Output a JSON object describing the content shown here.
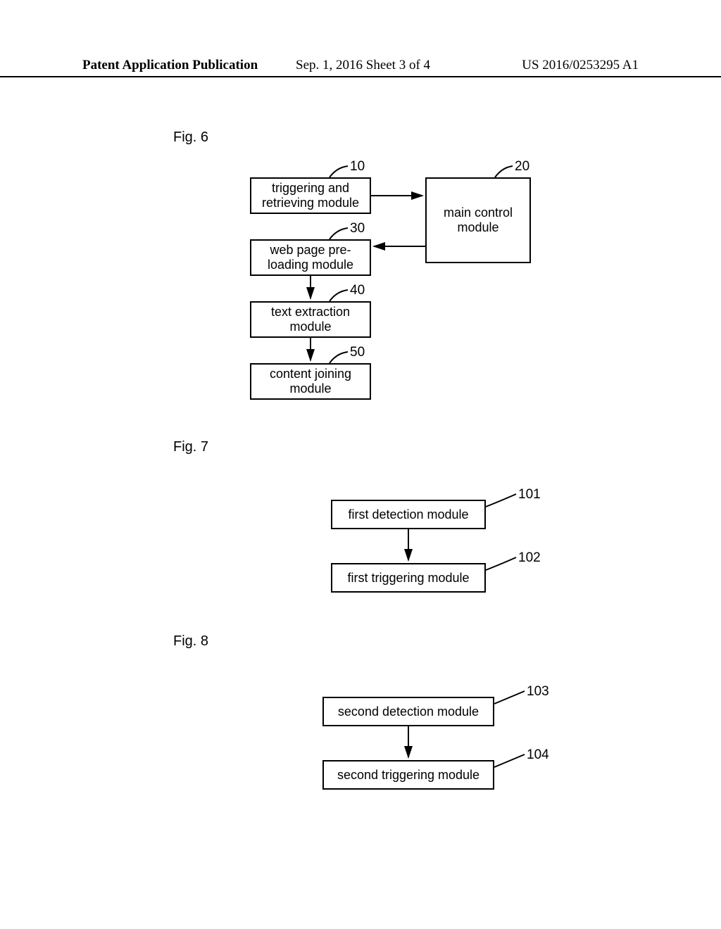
{
  "header": {
    "left": "Patent Application Publication",
    "mid": "Sep. 1, 2016  Sheet 3 of 4",
    "right": "US 2016/0253295 A1"
  },
  "figures": {
    "fig6": {
      "label": "Fig. 6",
      "blocks": {
        "triggering": {
          "text": "triggering and\nretrieving module",
          "ref": "10"
        },
        "maincontrol": {
          "text": "main control\nmodule",
          "ref": "20"
        },
        "preload": {
          "text": "web page pre-\nloading module",
          "ref": "30"
        },
        "textext": {
          "text": "text extraction\nmodule",
          "ref": "40"
        },
        "join": {
          "text": "content joining\nmodule",
          "ref": "50"
        }
      }
    },
    "fig7": {
      "label": "Fig. 7",
      "blocks": {
        "det1": {
          "text": "first detection module",
          "ref": "101"
        },
        "trig1": {
          "text": "first triggering module",
          "ref": "102"
        }
      }
    },
    "fig8": {
      "label": "Fig. 8",
      "blocks": {
        "det2": {
          "text": "second detection module",
          "ref": "103"
        },
        "trig2": {
          "text": "second triggering module",
          "ref": "104"
        }
      }
    }
  },
  "chart_data": [
    {
      "type": "diagram",
      "title": "Fig. 6",
      "nodes": [
        {
          "id": "10",
          "label": "triggering and retrieving module"
        },
        {
          "id": "20",
          "label": "main control module"
        },
        {
          "id": "30",
          "label": "web page pre-loading module"
        },
        {
          "id": "40",
          "label": "text extraction module"
        },
        {
          "id": "50",
          "label": "content joining module"
        }
      ],
      "edges": [
        {
          "from": "10",
          "to": "20"
        },
        {
          "from": "20",
          "to": "30"
        },
        {
          "from": "30",
          "to": "40"
        },
        {
          "from": "40",
          "to": "50"
        }
      ]
    },
    {
      "type": "diagram",
      "title": "Fig. 7",
      "nodes": [
        {
          "id": "101",
          "label": "first detection module"
        },
        {
          "id": "102",
          "label": "first triggering module"
        }
      ],
      "edges": [
        {
          "from": "101",
          "to": "102"
        }
      ]
    },
    {
      "type": "diagram",
      "title": "Fig. 8",
      "nodes": [
        {
          "id": "103",
          "label": "second detection module"
        },
        {
          "id": "104",
          "label": "second triggering module"
        }
      ],
      "edges": [
        {
          "from": "103",
          "to": "104"
        }
      ]
    }
  ]
}
